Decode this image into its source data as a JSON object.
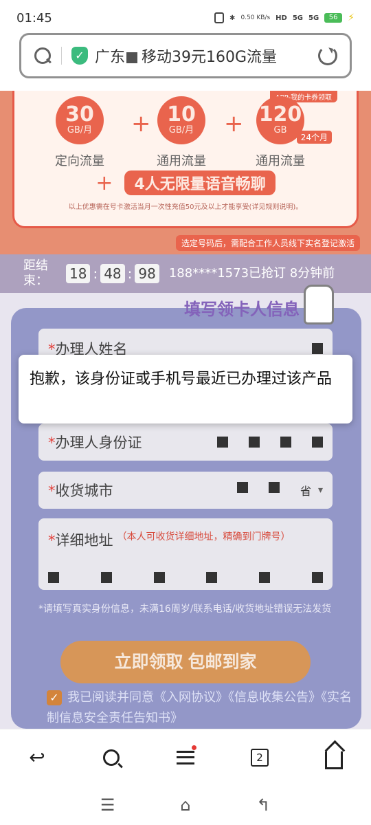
{
  "status_bar": {
    "time": "01:45",
    "network_speed": "0.50\nKB/s",
    "hd_label": "HD",
    "sim1_label": "5G",
    "sim2_label": "5G",
    "battery": "56"
  },
  "address_bar": {
    "text_prefix": "广东",
    "text_suffix": "移动39元160G流量"
  },
  "hero": {
    "badge": "APP-我的卡券领取",
    "plans": [
      {
        "num": "30",
        "unit": "GB/月",
        "label": "定向流量"
      },
      {
        "num": "10",
        "unit": "GB/月",
        "label": "通用流量"
      },
      {
        "num": "120",
        "unit": "GB",
        "label": "通用流量"
      }
    ],
    "term": "24个月",
    "voice": "4人无限量语音畅聊",
    "note": "以上优惠需在号卡激活当月一次性充值50元及以上才能享受(详见规则说明)。",
    "tip": "选定号码后，需配合工作人员线下实名登记激活"
  },
  "countdown": {
    "label": "距结束：",
    "hours": "18",
    "minutes": "48",
    "seconds": "98",
    "notice": "188****1573已抢订 8分钟前"
  },
  "form": {
    "section_title": "填写领卡人信息",
    "required_mark": "*",
    "name_label": "办理人姓名",
    "id_label": "办理人身份证",
    "city_label": "收货城市",
    "city_value_suffix": "省",
    "address_label": "详细地址",
    "address_hint": "（本人可收货详细地址，精确到门牌号）",
    "disclaimer": "*请填写真实身份信息，未满16周岁/联系电话/收货地址错误无法发货",
    "cta": "立即领取  包邮到家",
    "agree_text": "我已阅读并同意《入网协议》《信息收集公告》《实名制信息安全责任告知书》"
  },
  "toast": {
    "message": "抱歉，该身份证或手机号最近已办理过该产品"
  },
  "toolbar": {
    "tab_count": "2",
    "icons": [
      "back-icon",
      "search-icon",
      "menu-icon",
      "tabs-icon",
      "home-icon"
    ]
  },
  "system_nav": {
    "icons": [
      "recent-apps-icon",
      "home-icon",
      "back-icon"
    ]
  }
}
